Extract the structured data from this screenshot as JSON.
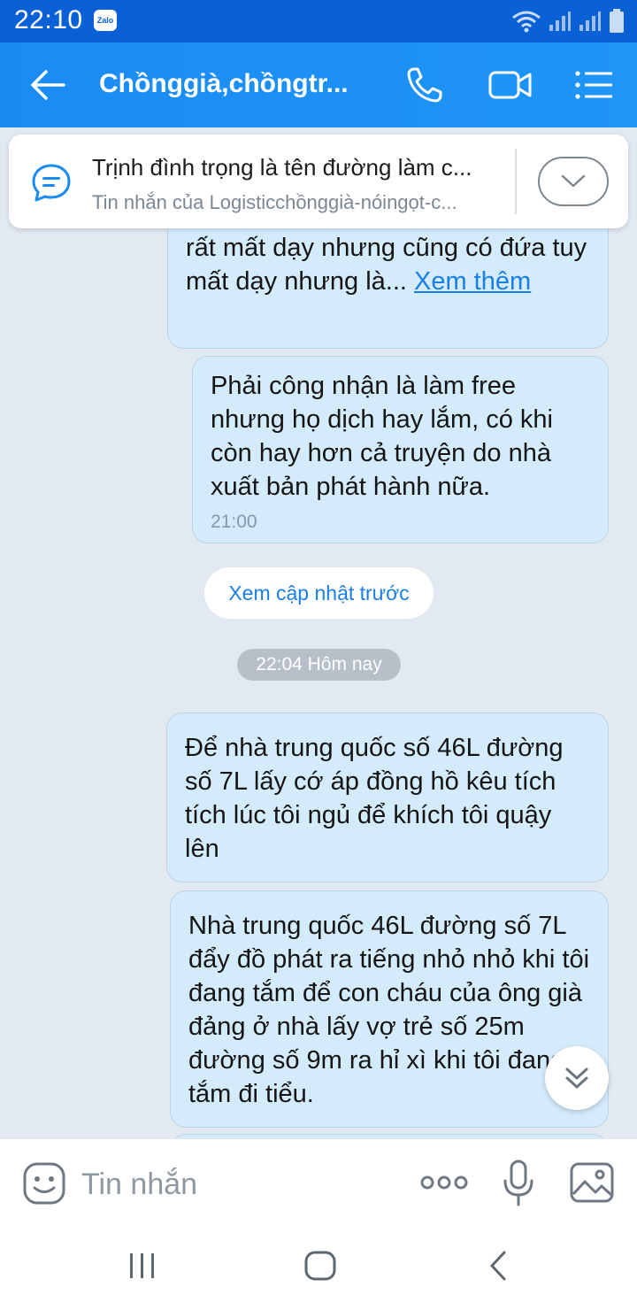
{
  "status_bar": {
    "time": "22:10",
    "app_badge": "Zalo"
  },
  "header": {
    "title": "Chồnggià,chồngtr..."
  },
  "pinned": {
    "title": "Trịnh đình trọng là tên đường làm c...",
    "subtitle": "Tin nhắn của Logisticchồnggià-nóingọt-c..."
  },
  "messages": [
    {
      "text": "rất mất dạy nhưng cũng có đứa tuy mất dạy nhưng là... ",
      "see_more": "Xem thêm"
    },
    {
      "text": "Phải công nhận là làm free nhưng họ dịch hay lắm, có khi còn hay hơn cả truyện do nhà xuất bản phát hành nữa.",
      "time": "21:00"
    },
    {
      "text": "Để nhà trung quốc số 46L đường số 7L lấy cớ áp đồng hồ kêu tích tích lúc tôi ngủ để khích tôi quậy lên"
    },
    {
      "text": "Nhà trung quốc 46L đường số 7L đẩy đồ phát ra tiếng nhỏ nhỏ khi tôi đang tắm để con cháu của ông già đảng ở nhà lấy vợ trẻ số 25m đường số 9m ra hỉ xì khi tôi đang tắm đi tiểu."
    }
  ],
  "load_previous": "Xem cập nhật trước",
  "date_separator": "22:04 Hôm nay",
  "input": {
    "placeholder": "Tin nhắn"
  },
  "colors": {
    "header": "#1f95f6",
    "status_bar": "#0a61d6",
    "bubble": "#d4ebfc",
    "link": "#1a7fe2",
    "chat_bg": "#e2e9f1"
  },
  "icons": [
    "back-arrow-icon",
    "phone-icon",
    "video-call-icon",
    "menu-list-icon",
    "chat-bubble-icon",
    "chevron-down-icon",
    "sticker-icon",
    "more-icon",
    "microphone-icon",
    "image-icon"
  ]
}
